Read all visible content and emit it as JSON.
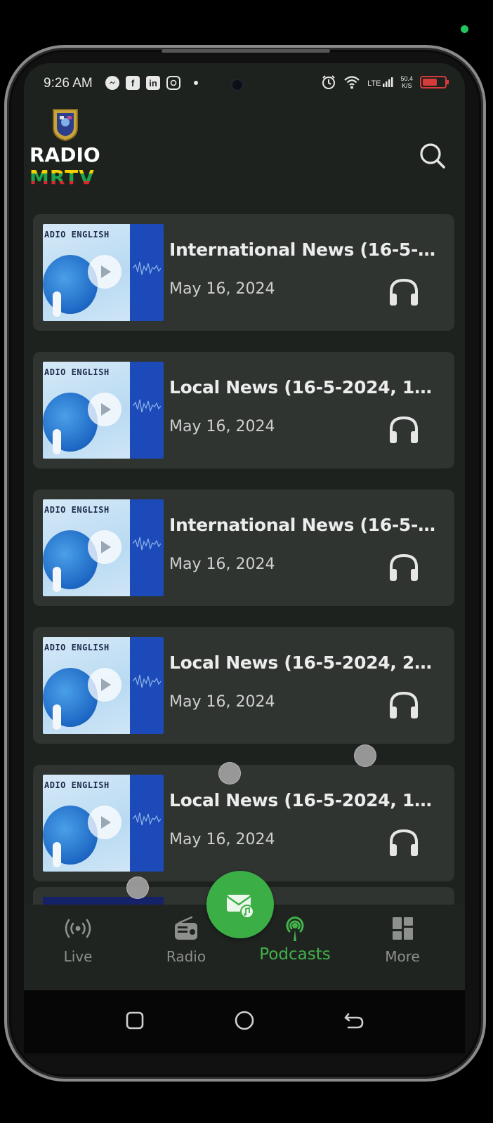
{
  "status_bar": {
    "time": "9:26 AM",
    "notification_icons": [
      "messenger-icon",
      "facebook-icon",
      "linkedin-icon",
      "instagram-icon"
    ],
    "network": "LTE",
    "speed_value": "50.4",
    "speed_unit": "K/S",
    "battery_color": "#d63b3b"
  },
  "header": {
    "logo_line1": "RADIO",
    "logo_line2": "MRTV",
    "search_icon": "search-icon"
  },
  "thumbnail_label": "ADIO ENGLISH",
  "episodes": [
    {
      "title": "International News (16-5-2...",
      "date": "May 16, 2024"
    },
    {
      "title": "Local News (16-5-2024, 10 ...",
      "date": "May 16, 2024"
    },
    {
      "title": "International News (16-5-2...",
      "date": "May 16, 2024"
    },
    {
      "title": "Local News (16-5-2024, 2 P...",
      "date": "May 16, 2024"
    },
    {
      "title": "Local News (16-5-2024, 10 ...",
      "date": "May 16, 2024"
    }
  ],
  "bottom_nav": {
    "items": [
      {
        "label": "Live",
        "icon": "broadcast-icon"
      },
      {
        "label": "Radio",
        "icon": "radio-icon"
      },
      {
        "label": "Podcasts",
        "icon": "podcast-icon",
        "active": true
      },
      {
        "label": "More",
        "icon": "grid-icon"
      }
    ],
    "fab_icon": "mail-music-icon"
  },
  "colors": {
    "background": "#1d221e",
    "card": "#2f3431",
    "accent_green": "#42b24a",
    "fab_green": "#3cae46"
  }
}
